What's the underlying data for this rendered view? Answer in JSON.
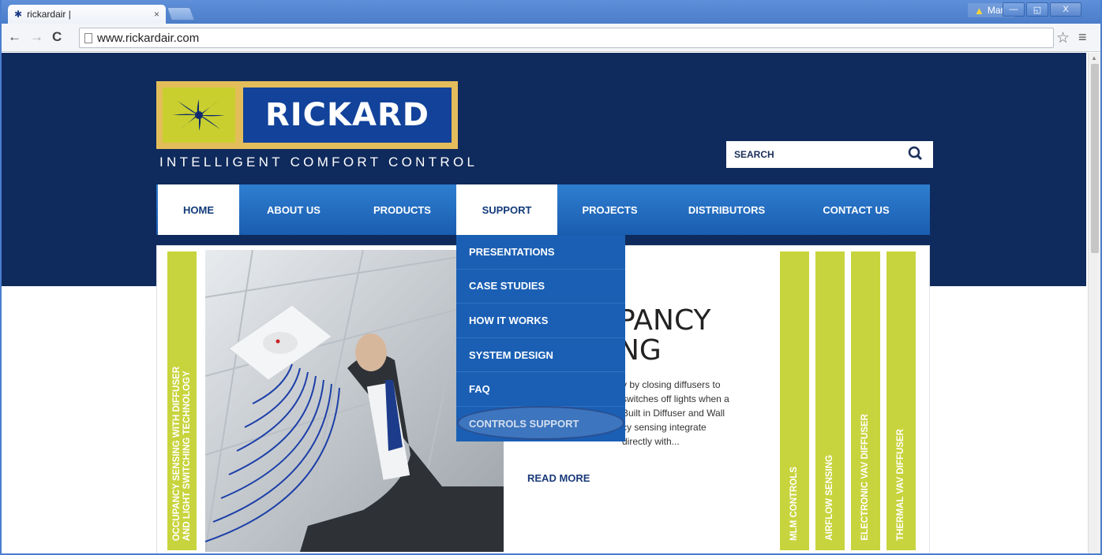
{
  "browser": {
    "tab_title": "rickardair |",
    "tab_close": "×",
    "url": "www.rickardair.com",
    "user_name": "Mark",
    "window_buttons": [
      "—",
      "◱",
      "X"
    ]
  },
  "header": {
    "brand_name": "RICKARD",
    "tagline": "INTELLIGENT COMFORT CONTROL",
    "search_placeholder": "SEARCH"
  },
  "nav": {
    "items": [
      {
        "label": "HOME",
        "active": true
      },
      {
        "label": "ABOUT US"
      },
      {
        "label": "PRODUCTS"
      },
      {
        "label": "SUPPORT",
        "active": true
      },
      {
        "label": "PROJECTS"
      },
      {
        "label": "DISTRIBUTORS"
      },
      {
        "label": "CONTACT US"
      }
    ]
  },
  "support_menu": {
    "items": [
      "PRESENTATIONS",
      "CASE STUDIES",
      "HOW IT WORKS",
      "SYSTEM DESIGN",
      "FAQ",
      "CONTROLS SUPPORT"
    ],
    "highlighted": "CONTROLS SUPPORT"
  },
  "slider": {
    "left_tab": "OCCUPANCY SENSING WITH DIFFUSER\nAND LIGHT SWITCHING TECHNOLOGY",
    "title_line1": "PANCY",
    "title_line2": "NG",
    "body_lines": [
      "y by closing diffusers to",
      "switches off lights when a",
      "Built in Diffuser and Wall",
      "cy sensing integrate",
      "directly with..."
    ],
    "read_more": "READ MORE",
    "right_tabs": [
      "MLM CONTROLS",
      "AIRFLOW SENSING",
      "ELECTRONIC VAV DIFFUSER",
      "THERMAL VAV DIFFUSER"
    ]
  }
}
